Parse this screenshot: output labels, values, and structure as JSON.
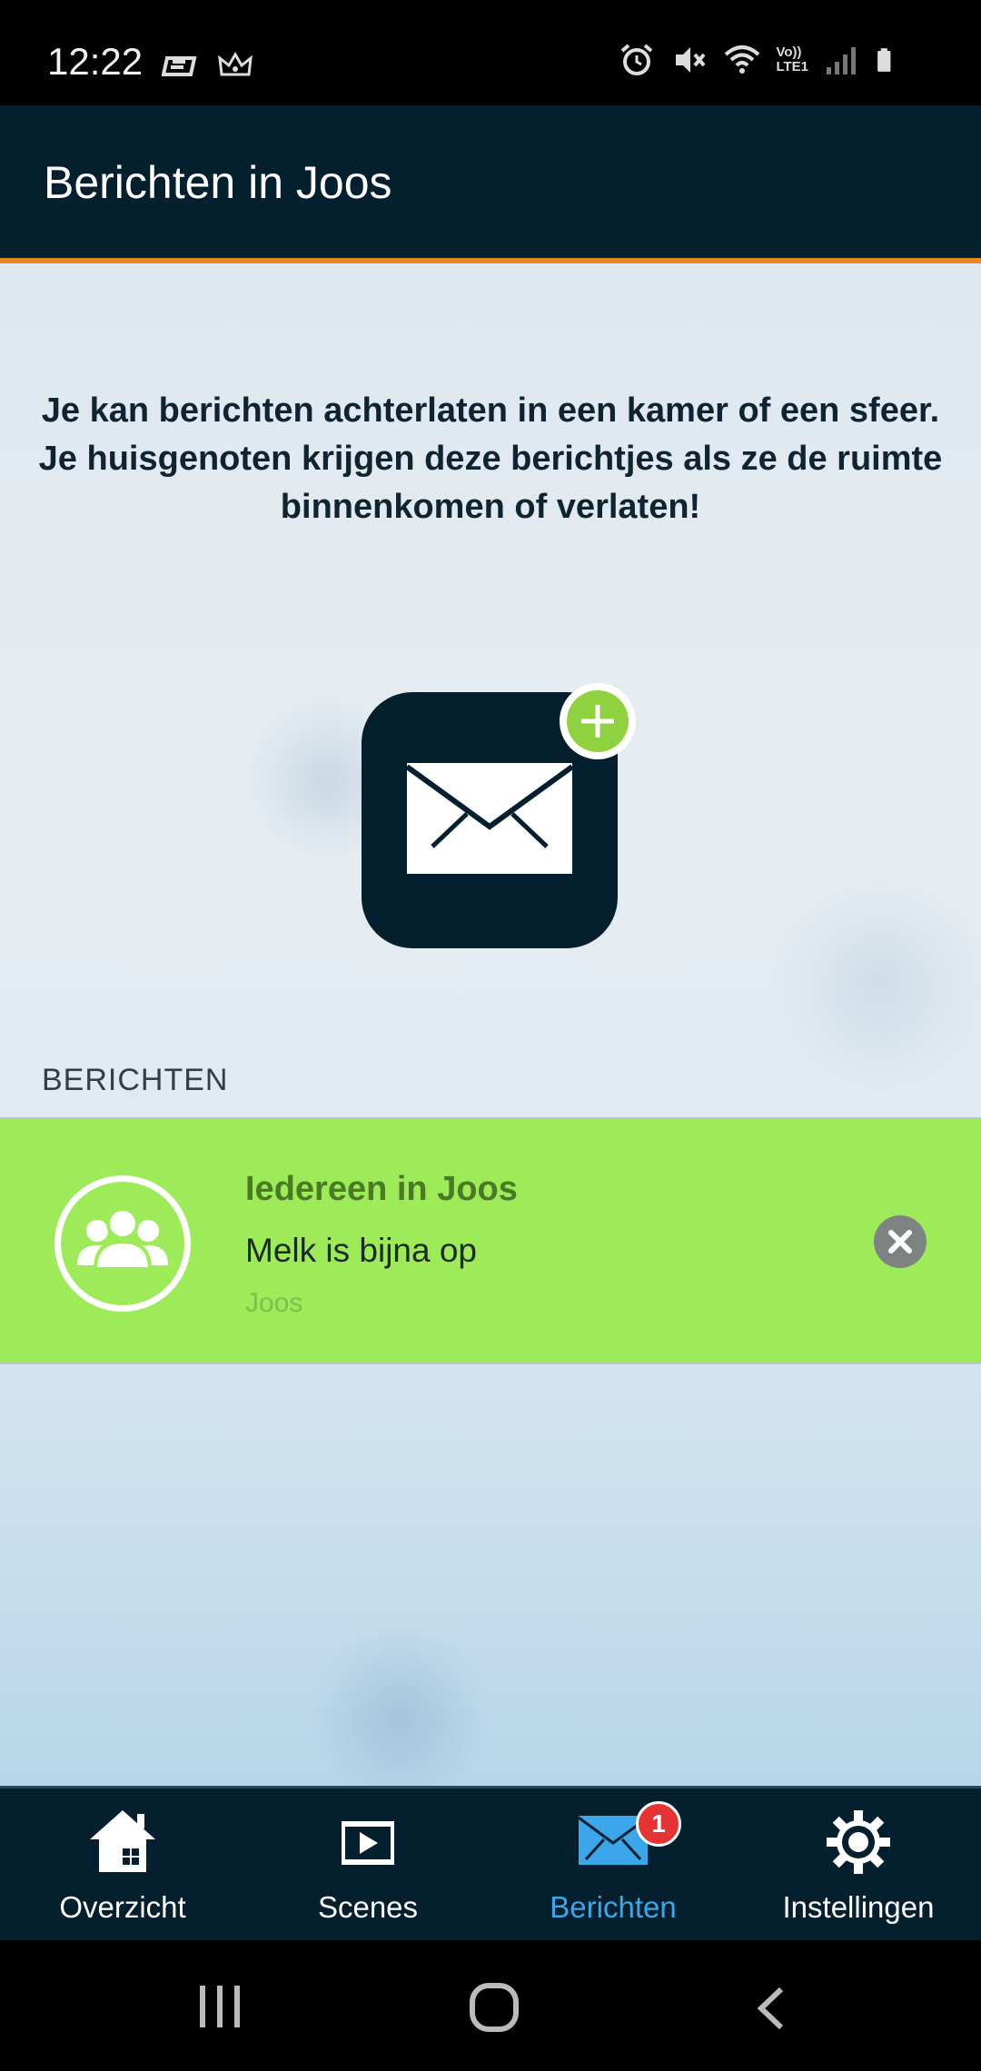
{
  "status_bar": {
    "time": "12:22",
    "left_icons": [
      "game-icon",
      "crown-icon"
    ],
    "right_icons": [
      "alarm-icon",
      "mute-icon",
      "wifi-icon",
      "volte-icon",
      "signal-icon",
      "battery-icon"
    ],
    "volte_label_top": "Vo))",
    "volte_label_bottom": "LTE1"
  },
  "app_bar": {
    "title": "Berichten in Joos"
  },
  "main": {
    "intro_text": "Je kan berichten achterlaten in een kamer of een sfeer. Je huisgenoten krijgen deze berichtjes als ze de ruimte binnenkomen of verlaten!",
    "section_label": "BERICHTEN",
    "messages": [
      {
        "recipient": "Iedereen in Joos",
        "body": "Melk is bijna op",
        "room": "Joos"
      }
    ]
  },
  "bottom_nav": {
    "items": [
      {
        "label": "Overzicht",
        "icon": "home-icon"
      },
      {
        "label": "Scenes",
        "icon": "scenes-icon"
      },
      {
        "label": "Berichten",
        "icon": "mail-icon",
        "badge": "1",
        "active": true
      },
      {
        "label": "Instellingen",
        "icon": "gear-icon"
      }
    ]
  },
  "colors": {
    "app_bar": "#04202e",
    "accent": "#e8862a",
    "message_card": "#9deb59",
    "active_nav": "#3ba7ea",
    "badge": "#e53333"
  }
}
